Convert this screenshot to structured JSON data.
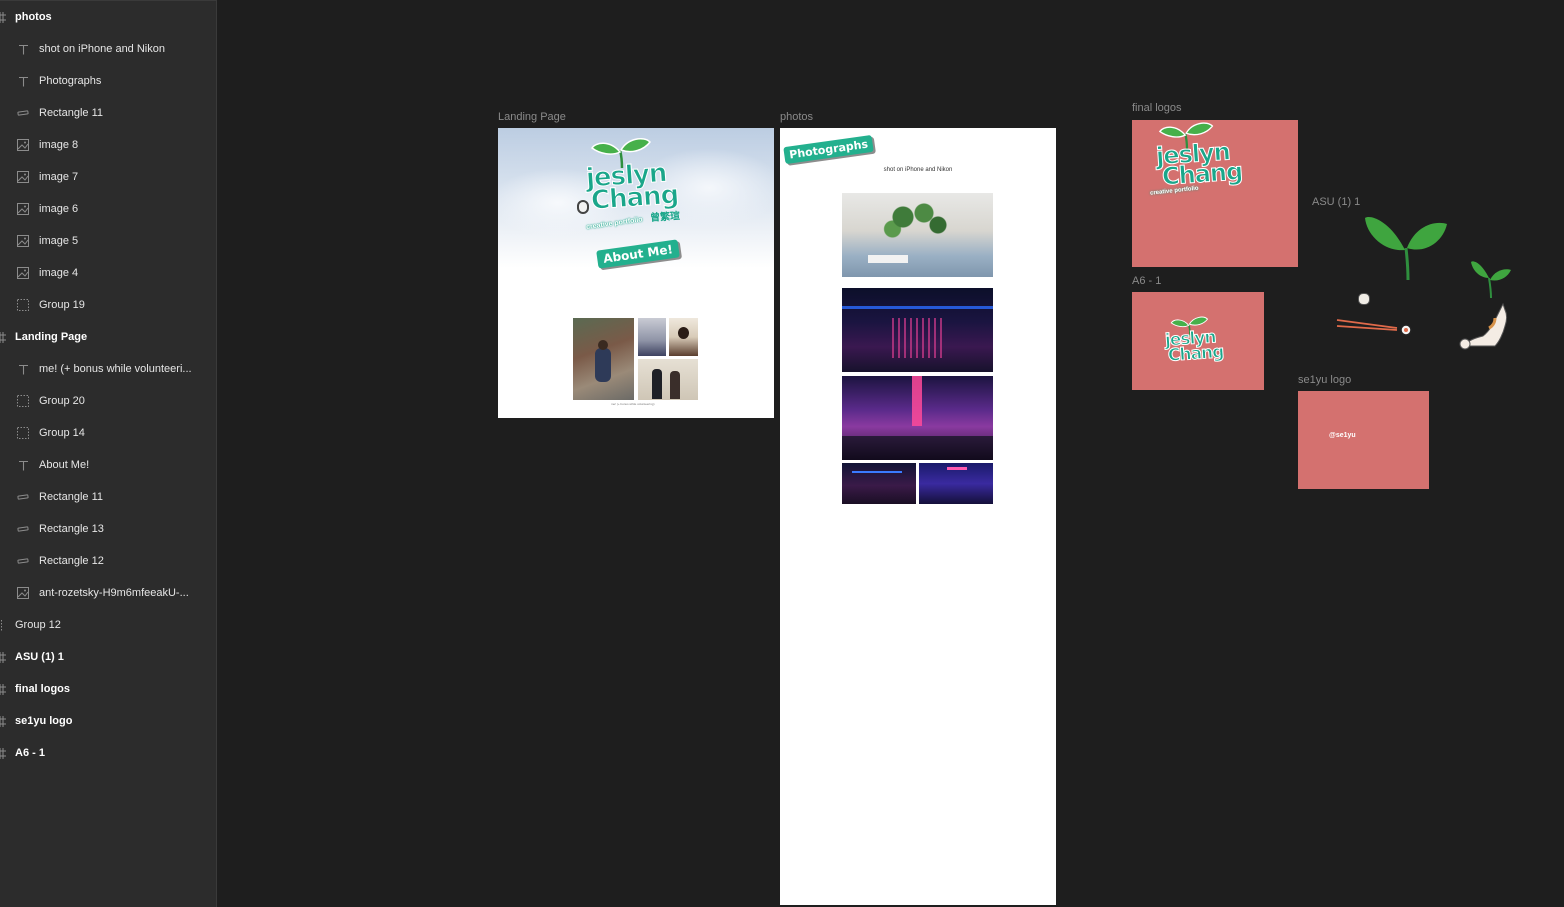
{
  "layers": [
    {
      "label": "photos",
      "type": "frame",
      "icon": "frame-icon",
      "level": 0
    },
    {
      "label": "shot on iPhone and Nikon",
      "type": "text",
      "icon": "text-icon",
      "level": 1
    },
    {
      "label": "Photographs",
      "type": "text",
      "icon": "text-icon",
      "level": 1
    },
    {
      "label": "Rectangle 11",
      "type": "rect",
      "icon": "rectangle-icon",
      "level": 1
    },
    {
      "label": "image 8",
      "type": "image",
      "icon": "image-icon",
      "level": 1
    },
    {
      "label": "image 7",
      "type": "image",
      "icon": "image-icon",
      "level": 1
    },
    {
      "label": "image 6",
      "type": "image",
      "icon": "image-icon",
      "level": 1
    },
    {
      "label": "image 5",
      "type": "image",
      "icon": "image-icon",
      "level": 1
    },
    {
      "label": "image 4",
      "type": "image",
      "icon": "image-icon",
      "level": 1
    },
    {
      "label": "Group 19",
      "type": "group",
      "icon": "group-icon",
      "level": 1
    },
    {
      "label": "Landing Page",
      "type": "frame",
      "icon": "frame-icon",
      "level": 0
    },
    {
      "label": "me! (+ bonus while volunteeri...",
      "type": "text",
      "icon": "text-icon",
      "level": 1
    },
    {
      "label": "Group 20",
      "type": "group",
      "icon": "group-icon",
      "level": 1
    },
    {
      "label": "Group 14",
      "type": "group",
      "icon": "group-icon",
      "level": 1
    },
    {
      "label": "About Me!",
      "type": "text",
      "icon": "text-icon",
      "level": 1
    },
    {
      "label": "Rectangle 11",
      "type": "rect",
      "icon": "rectangle-icon",
      "level": 1
    },
    {
      "label": "Rectangle 13",
      "type": "rect",
      "icon": "rectangle-icon",
      "level": 1
    },
    {
      "label": "Rectangle 12",
      "type": "rect",
      "icon": "rectangle-icon",
      "level": 1
    },
    {
      "label": "ant-rozetsky-H9m6mfeeakU-...",
      "type": "image",
      "icon": "image-icon",
      "level": 1
    },
    {
      "label": "Group 12",
      "type": "group",
      "icon": "group-icon",
      "level": 0
    },
    {
      "label": "ASU (1) 1",
      "type": "frame",
      "icon": "frame-icon",
      "level": 0
    },
    {
      "label": "final logos",
      "type": "frame",
      "icon": "frame-icon",
      "level": 0
    },
    {
      "label": "se1yu logo",
      "type": "frame",
      "icon": "frame-icon",
      "level": 0
    },
    {
      "label": "A6 - 1",
      "type": "frame",
      "icon": "frame-icon",
      "level": 0
    }
  ],
  "canvas": {
    "landing": {
      "label": "Landing Page",
      "logo_name_line1": "jeslyn",
      "logo_name_line2": "Chang",
      "logo_chinese": "曾繁瑄",
      "logo_sub": "creative portfolio",
      "about_label": "About Me!",
      "caption": "me! (+ bonus while volunteering)"
    },
    "photos": {
      "label": "photos",
      "heading": "Photographs",
      "subtitle": "shot on iPhone and Nikon"
    },
    "final_logos": {
      "label": "final logos"
    },
    "asu": {
      "label": "ASU  (1) 1"
    },
    "a6": {
      "label": "A6 - 1"
    },
    "se1yu": {
      "label": "se1yu logo",
      "handle": "@se1yu"
    }
  },
  "colors": {
    "panel_bg": "#2c2c2c",
    "canvas_bg": "#1e1e1e",
    "logo_green": "#1aa68a",
    "pink_board": "#d4716f"
  }
}
